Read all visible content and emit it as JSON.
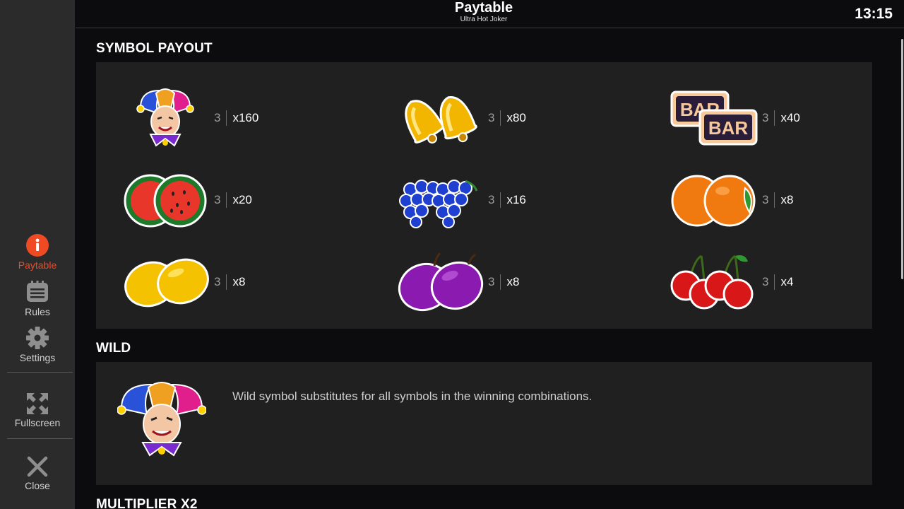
{
  "header": {
    "title": "Paytable",
    "subtitle": "Ultra Hot Joker",
    "time": "13:15"
  },
  "sidebar": {
    "items": [
      {
        "label": "Paytable",
        "icon": "info-icon",
        "active": true
      },
      {
        "label": "Rules",
        "icon": "rules-icon",
        "active": false
      },
      {
        "label": "Settings",
        "icon": "gear-icon",
        "active": false
      },
      {
        "label": "Fullscreen",
        "icon": "fullscreen-icon",
        "active": false
      },
      {
        "label": "Close",
        "icon": "close-icon",
        "active": false
      }
    ]
  },
  "sections": {
    "symbol_payout": {
      "title": "SYMBOL PAYOUT",
      "items": [
        {
          "symbol": "joker",
          "count": "3",
          "multiplier": "x160"
        },
        {
          "symbol": "bells",
          "count": "3",
          "multiplier": "x80"
        },
        {
          "symbol": "bar",
          "count": "3",
          "multiplier": "x40",
          "symbol_text": "BAR"
        },
        {
          "symbol": "watermelons",
          "count": "3",
          "multiplier": "x20"
        },
        {
          "symbol": "grapes",
          "count": "3",
          "multiplier": "x16"
        },
        {
          "symbol": "oranges",
          "count": "3",
          "multiplier": "x8"
        },
        {
          "symbol": "lemons",
          "count": "3",
          "multiplier": "x8"
        },
        {
          "symbol": "plums",
          "count": "3",
          "multiplier": "x8"
        },
        {
          "symbol": "cherries",
          "count": "3",
          "multiplier": "x4"
        }
      ]
    },
    "wild": {
      "title": "WILD",
      "description": "Wild symbol substitutes for all symbols in the winning combinations."
    },
    "multiplier": {
      "title": "MULTIPLIER X2"
    }
  },
  "colors": {
    "accent": "#f04a25",
    "panel": "#202020",
    "sidebar": "#2b2b2b",
    "background": "#0c0c0e"
  }
}
